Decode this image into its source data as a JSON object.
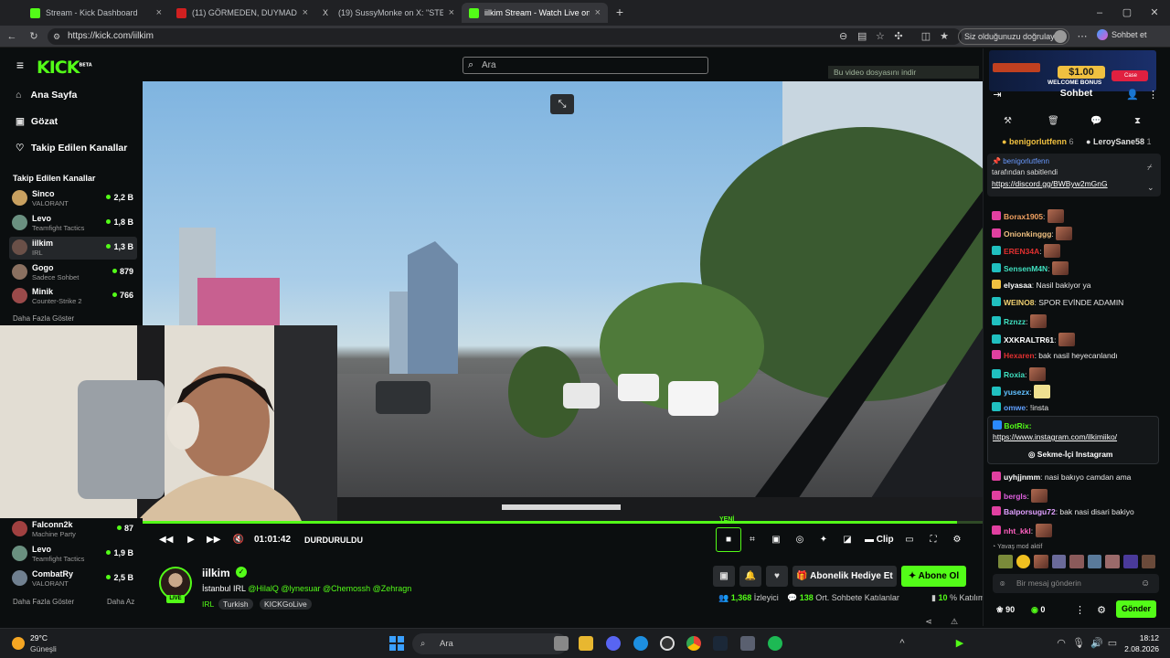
{
  "browser": {
    "tabs": [
      {
        "title": "Stream - Kick Dashboard",
        "color": "#53fc18",
        "active": false
      },
      {
        "title": "(11) GÖRMEDEN, DUYMADAN VE",
        "color": "#d02020",
        "active": false
      },
      {
        "title": "(19) SussyMonke on X: \"STEAM YE",
        "color": "#888888",
        "active": false
      },
      {
        "title": "iilkim Stream - Watch Live on Kick",
        "color": "#53fc18",
        "active": true
      }
    ],
    "new_tab": "+",
    "url": "https://kick.com/iilkim",
    "verify_label": "Siz olduğunuzu doğrulayın",
    "chat_label": "Sohbet et"
  },
  "kick": {
    "logo": "KICK",
    "logo_beta": "BETA",
    "search_placeholder": "Ara",
    "nav": [
      {
        "label": "Ana Sayfa",
        "icon": "home-icon",
        "glyph": "⌂"
      },
      {
        "label": "Gözat",
        "icon": "browse-icon",
        "glyph": "▣"
      },
      {
        "label": "Takip Edilen Kanallar",
        "icon": "heart-icon",
        "glyph": "♡"
      }
    ],
    "followed_heading": "Takip Edilen Kanallar",
    "followed": [
      {
        "name": "Sinco",
        "game": "VALORANT",
        "viewers": "2,2 B",
        "color": "#c8a060"
      },
      {
        "name": "Levo",
        "game": "Teamfight Tactics",
        "viewers": "1,8 B",
        "color": "#6a9080"
      },
      {
        "name": "iilkim",
        "game": "IRL",
        "viewers": "1,3 B",
        "color": "#6a5048"
      },
      {
        "name": "Gogo",
        "game": "Sadece Sohbet",
        "viewers": "879",
        "color": "#8a7060"
      },
      {
        "name": "Minik",
        "game": "Counter-Strike 2",
        "viewers": "766",
        "color": "#9a4a4a"
      }
    ],
    "show_more": "Daha Fazla Göster",
    "followed_lower": [
      {
        "name": "Falconn2k",
        "game": "Machine Party",
        "viewers": "87",
        "color": "#a04040"
      },
      {
        "name": "Levo",
        "game": "Teamfight Tactics",
        "viewers": "1,9 B",
        "color": "#6a9080"
      },
      {
        "name": "CombatRy",
        "game": "VALORANT",
        "viewers": "2,5 B",
        "color": "#708090"
      }
    ],
    "show_more_2": "Daha Fazla Göster",
    "show_less": "Daha Az"
  },
  "video": {
    "tooltip": "Bu video dosyasını indir",
    "time": "01:01:42",
    "status": "DURDURULDU",
    "new_badge": "YENİ",
    "clip_label": "Clip",
    "progress": 0.97
  },
  "channel": {
    "name": "iilkim",
    "live": "LIVE",
    "title_prefix": "İstanbul IRL ",
    "title_mentions": "@HilalQ @lynesuar @Chemossh @Zehragn",
    "category": "IRL",
    "tags": [
      "Turkish",
      "KICKGoLive"
    ],
    "gift_label": "Abonelik Hediye Et",
    "sub_label": "Abone Ol",
    "viewers": "1,368",
    "viewers_label": "İzleyici",
    "chatters": "138",
    "chatters_label": "Ort. Sohbete Katılanlar",
    "percent": "10",
    "percent_label": "% Katılım"
  },
  "chat": {
    "header": "Sohbet",
    "ad_amount": "$1.00",
    "ad_text": "WELCOME BONUS",
    "ad_brand": "Case",
    "leaderboard": [
      {
        "name": "benigorlutfenn",
        "count": "6",
        "color": "#f0c040"
      },
      {
        "name": "LeroySane58",
        "count": "1",
        "color": "#e0e0e0"
      }
    ],
    "pinned_user": "benigorlutfenn",
    "pinned_by": "tarafından sabitlendi",
    "pinned_link": "https://discord.gg/BWByw2mGnG",
    "messages": [
      {
        "user": "Borax1905",
        "color": "#f0a060",
        "text": "",
        "emote": true,
        "badge": "#e040a0"
      },
      {
        "user": "Onionkinggg",
        "color": "#f0c080",
        "text": "",
        "emote": true,
        "badge": "#e040a0"
      },
      {
        "user": "EREN34A",
        "color": "#e03030",
        "text": "",
        "emote": true,
        "badge": "#20c0c0"
      },
      {
        "user": "SensenM4N",
        "color": "#40e0c0",
        "text": "",
        "emote": true,
        "badge": "#20c0c0"
      },
      {
        "user": "elyasaa",
        "color": "#ffffff",
        "text": "Nasil bakiyor ya",
        "emote": false,
        "badge": "#f0c040"
      },
      {
        "user": "WEINO8",
        "color": "#f0d070",
        "text": "SPOR EVİNDE ADAMIN",
        "emote": false,
        "badge": "#20c0c0"
      },
      {
        "user": "Rznzz",
        "color": "#40e0c0",
        "text": "",
        "emote": true,
        "badge": "#20c0c0"
      },
      {
        "user": "XXKRALTR61",
        "color": "#ffffff",
        "text": "",
        "emote": true,
        "badge": "#20c0c0"
      },
      {
        "user": "Hexaren",
        "color": "#e03030",
        "text": "bak nasil heyecanlandı",
        "emote": false,
        "badge": "#e040a0"
      },
      {
        "user": "Roxia",
        "color": "#40e0c0",
        "text": "",
        "emote": true,
        "badge": "#20c0c0"
      },
      {
        "user": "yusezx",
        "color": "#60c0ff",
        "text": "",
        "emote": true,
        "badge": "#20c0c0"
      },
      {
        "user": "omwe",
        "color": "#60a0ff",
        "text": "!insta",
        "emote": false,
        "badge": "#20c0c0"
      }
    ],
    "bot_user": "BotRix",
    "bot_link": "https://www.instagram.com/ilkimiiko/",
    "bot_button": "Sekme-İçi Instagram",
    "messages2": [
      {
        "user": "uyhjjnmm",
        "color": "#ffffff",
        "text": "nasi bakıyo camdan ama",
        "emote": false,
        "badge": "#e040a0"
      },
      {
        "user": "bergls",
        "color": "#e060e0",
        "text": "",
        "emote": true,
        "badge": "#e040a0"
      },
      {
        "user": "Balporsugu72",
        "color": "#e0a0ff",
        "text": "bak nasi disari bakiyo",
        "emote": false,
        "badge": "#e040a0"
      },
      {
        "user": "nht_kkl",
        "color": "#ff60c0",
        "text": "",
        "emote": true,
        "badge": "#e040a0"
      }
    ],
    "slow_mode": "Yavaş mod aktif",
    "input_placeholder": "Bir mesaj gönderin",
    "points": "90",
    "points2": "0",
    "send_label": "Gönder"
  },
  "taskbar": {
    "weather_temp": "29°C",
    "weather_text": "Güneşli",
    "search": "Ara",
    "time": "18:12",
    "date": "2.08.2026"
  }
}
